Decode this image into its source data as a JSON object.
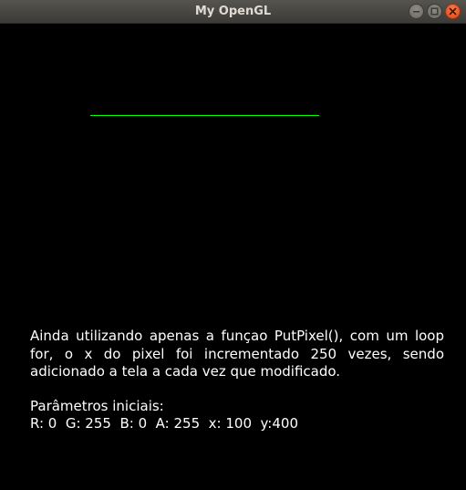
{
  "window": {
    "title": "My OpenGL",
    "buttons": {
      "minimize": "minimize-icon",
      "maximize": "maximize-icon",
      "close": "close-icon"
    }
  },
  "canvas": {
    "background": "#000000",
    "line_color": "#00ff00",
    "description": "Ainda utilizando apenas a funçao PutPixel(), com um loop for, o x do pixel foi incrementado 250 vezes, sendo adicionado a tela a cada vez que modificado.",
    "params_title": "Parâmetros iniciais:",
    "params_values": "R: 0  G: 255  B: 0  A: 255  x: 100  y:400"
  }
}
